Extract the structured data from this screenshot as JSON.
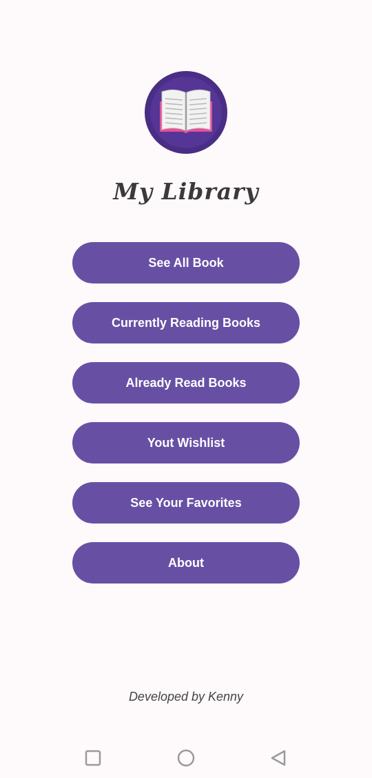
{
  "app": {
    "title": "My Library",
    "logo_icon": "open-book-icon",
    "colors": {
      "background": "#fef9fb",
      "button": "#6750a4",
      "button_text": "#ffffff",
      "logo_circle": "#4a2d84",
      "title_text": "#3a3a3a"
    }
  },
  "menu": {
    "buttons": [
      {
        "label": "See All Book"
      },
      {
        "label": "Currently Reading Books"
      },
      {
        "label": "Already Read Books"
      },
      {
        "label": "Yout Wishlist"
      },
      {
        "label": "See Your Favorites"
      },
      {
        "label": "About"
      }
    ]
  },
  "footer": {
    "credit": "Developed by Kenny"
  },
  "navbar": {
    "icons": [
      "recent-apps-icon",
      "home-icon",
      "back-icon"
    ]
  }
}
